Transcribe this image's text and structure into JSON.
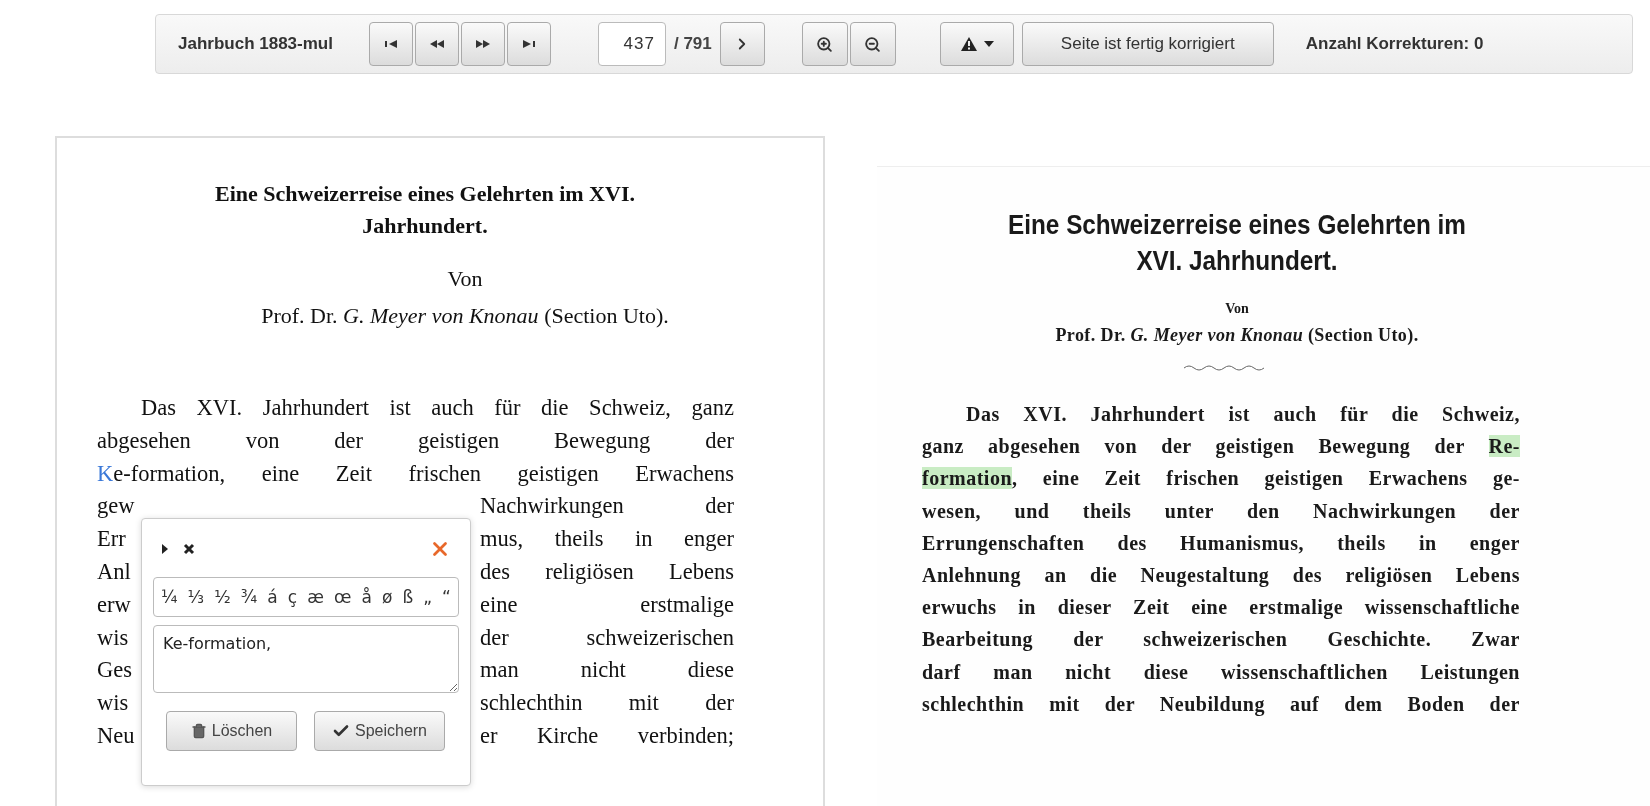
{
  "toolbar": {
    "title": "Jahrbuch 1883-mul",
    "nav_buttons": [
      {
        "kind": "first"
      },
      {
        "kind": "previous"
      },
      {
        "kind": "next"
      },
      {
        "kind": "last"
      }
    ],
    "page_input": "437",
    "page_total": "/ 791",
    "zoom_buttons": [
      {
        "kind": "zoom_in"
      },
      {
        "kind": "zoom_out"
      }
    ],
    "finish_button": "Seite ist fertig korrigiert",
    "corrections": "Anzahl Korrekturen: 0"
  },
  "transcription": {
    "title_lines": [
      "Eine Schweizerreise eines Gelehrten im XVI.",
      "Jahrhundert."
    ],
    "byline_intro": "Von",
    "byline": "Prof. Dr. *G. Meyer von Knonau* (Section Uto).",
    "lines": [
      {
        "kind": "first",
        "parts": [
          {
            "text": "Das XVI. Jahrhundert ist auch für die Schweiz, ganz",
            "marked": false
          }
        ]
      },
      {
        "kind": "full",
        "parts": [
          {
            "text": "abgesehen von der geistigen Bewegung der",
            "marked": false
          }
        ]
      },
      {
        "kind": "full",
        "parts": [
          {
            "text": "K",
            "marked": true
          },
          {
            "text": "e-formation, eine Zeit frischen geistigen Erwachens",
            "marked": false
          }
        ]
      },
      {
        "kind": "split",
        "start": "gew",
        "end": "Nachwirkungen der"
      },
      {
        "kind": "split",
        "start": "Err",
        "end": "mus, theils in enger"
      },
      {
        "kind": "split",
        "start": "Anl",
        "end": "des religiösen Lebens"
      },
      {
        "kind": "split",
        "start": "erw",
        "end": "eine erstmalige"
      },
      {
        "kind": "split",
        "start": "wis",
        "end": "der schweizerischen"
      },
      {
        "kind": "split",
        "start": "Ges",
        "end": "man nicht diese"
      },
      {
        "kind": "split",
        "start": "wis",
        "end": "schlechthin mit der"
      },
      {
        "kind": "split",
        "start": "Neu",
        "end": "er Kirche verbinden;"
      }
    ]
  },
  "editor": {
    "tools": [
      {
        "kind": "play"
      },
      {
        "kind": "clear"
      }
    ],
    "special_chars": [
      "¼",
      "⅓",
      "½",
      "¾",
      "á",
      "ç",
      "æ",
      "œ",
      "å",
      "ø",
      "ß",
      "„",
      "“"
    ],
    "value": "Ke-formation,",
    "buttons": [
      {
        "kind": "delete",
        "label": "Löschen"
      },
      {
        "kind": "save",
        "label": "Speichern"
      }
    ]
  },
  "scan": {
    "title_lines": [
      "Eine Schweizerreise eines Gelehrten im",
      "XVI. Jahrhundert."
    ],
    "byline_intro": "Von",
    "byline": "Prof. Dr. *G. Meyer von Knonau* (Section Uto).",
    "lines": [
      {
        "kind": "first",
        "parts": [
          {
            "text": "Das XVI. Jahrhundert ist auch für die Schweiz,",
            "highlighted": false
          }
        ]
      },
      {
        "kind": "full",
        "parts": [
          {
            "text": "ganz abgesehen von der geistigen Bewegung der ",
            "highlighted": false
          },
          {
            "text": "Re-",
            "highlighted": true
          }
        ]
      },
      {
        "kind": "full",
        "parts": [
          {
            "text": "formation",
            "highlighted": true
          },
          {
            "text": ", eine Zeit frischen geistigen Erwachens ge-",
            "highlighted": false
          }
        ]
      },
      {
        "kind": "full",
        "parts": [
          {
            "text": "wesen, und theils unter den Nachwirkungen der",
            "highlighted": false
          }
        ]
      },
      {
        "kind": "full",
        "parts": [
          {
            "text": "Errungenschaften des Humanismus, theils in enger",
            "highlighted": false
          }
        ]
      },
      {
        "kind": "full",
        "parts": [
          {
            "text": "Anlehnung an die Neugestaltung des religiösen Lebens",
            "highlighted": false
          }
        ]
      },
      {
        "kind": "full",
        "parts": [
          {
            "text": "erwuchs in dieser Zeit eine erstmalige wissenschaftliche",
            "highlighted": false
          }
        ]
      },
      {
        "kind": "full",
        "parts": [
          {
            "text": "Bearbeitung der schweizerischen Geschichte. Zwar",
            "highlighted": false
          }
        ]
      },
      {
        "kind": "full",
        "parts": [
          {
            "text": "darf man nicht diese wissenschaftlichen Leistungen",
            "highlighted": false
          }
        ]
      },
      {
        "kind": "full",
        "parts": [
          {
            "text": "schlechthin mit der Neubildung auf dem Boden der",
            "highlighted": false
          }
        ]
      }
    ]
  }
}
